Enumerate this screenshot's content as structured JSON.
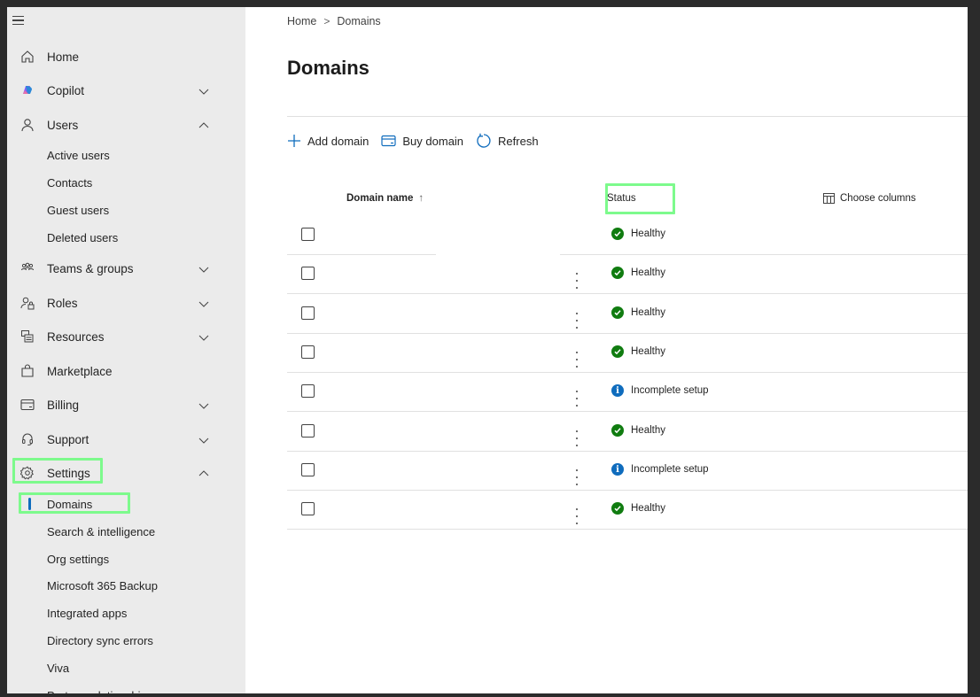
{
  "sidebar": {
    "items": [
      {
        "label": "Home",
        "icon": "home-icon"
      },
      {
        "label": "Copilot",
        "icon": "copilot-icon",
        "chevron": "down"
      },
      {
        "label": "Users",
        "icon": "person-icon",
        "chevron": "up"
      },
      {
        "label": "Teams & groups",
        "icon": "teams-icon",
        "chevron": "down"
      },
      {
        "label": "Roles",
        "icon": "roles-icon",
        "chevron": "down"
      },
      {
        "label": "Resources",
        "icon": "resources-icon",
        "chevron": "down"
      },
      {
        "label": "Marketplace",
        "icon": "bag-icon"
      },
      {
        "label": "Billing",
        "icon": "card-icon",
        "chevron": "down"
      },
      {
        "label": "Support",
        "icon": "headset-icon",
        "chevron": "down"
      },
      {
        "label": "Settings",
        "icon": "gear-icon",
        "chevron": "up"
      }
    ],
    "users_sub": [
      "Active users",
      "Contacts",
      "Guest users",
      "Deleted users"
    ],
    "settings_sub": [
      "Domains",
      "Search & intelligence",
      "Org settings",
      "Microsoft 365 Backup",
      "Integrated apps",
      "Directory sync errors",
      "Viva",
      "Partner relationships"
    ],
    "active_item": "Domains"
  },
  "breadcrumb": {
    "home": "Home",
    "sep": ">",
    "current": "Domains"
  },
  "page_title": "Domains",
  "toolbar": {
    "add": "Add domain",
    "buy": "Buy domain",
    "refresh": "Refresh"
  },
  "table": {
    "col_domain": "Domain name",
    "sort_arrow": "↑",
    "col_status": "Status",
    "choose_columns": "Choose columns",
    "rows": [
      {
        "status": "Healthy",
        "type": "ok"
      },
      {
        "status": "Healthy",
        "type": "ok"
      },
      {
        "status": "Healthy",
        "type": "ok"
      },
      {
        "status": "Healthy",
        "type": "ok"
      },
      {
        "status": "Incomplete setup",
        "type": "info"
      },
      {
        "status": "Healthy",
        "type": "ok"
      },
      {
        "status": "Incomplete setup",
        "type": "info"
      },
      {
        "status": "Healthy",
        "type": "ok"
      }
    ]
  },
  "colors": {
    "highlight": "#7dfa8c",
    "healthy": "#107c10",
    "info": "#0f6cbd",
    "accent": "#0f6cbd"
  }
}
